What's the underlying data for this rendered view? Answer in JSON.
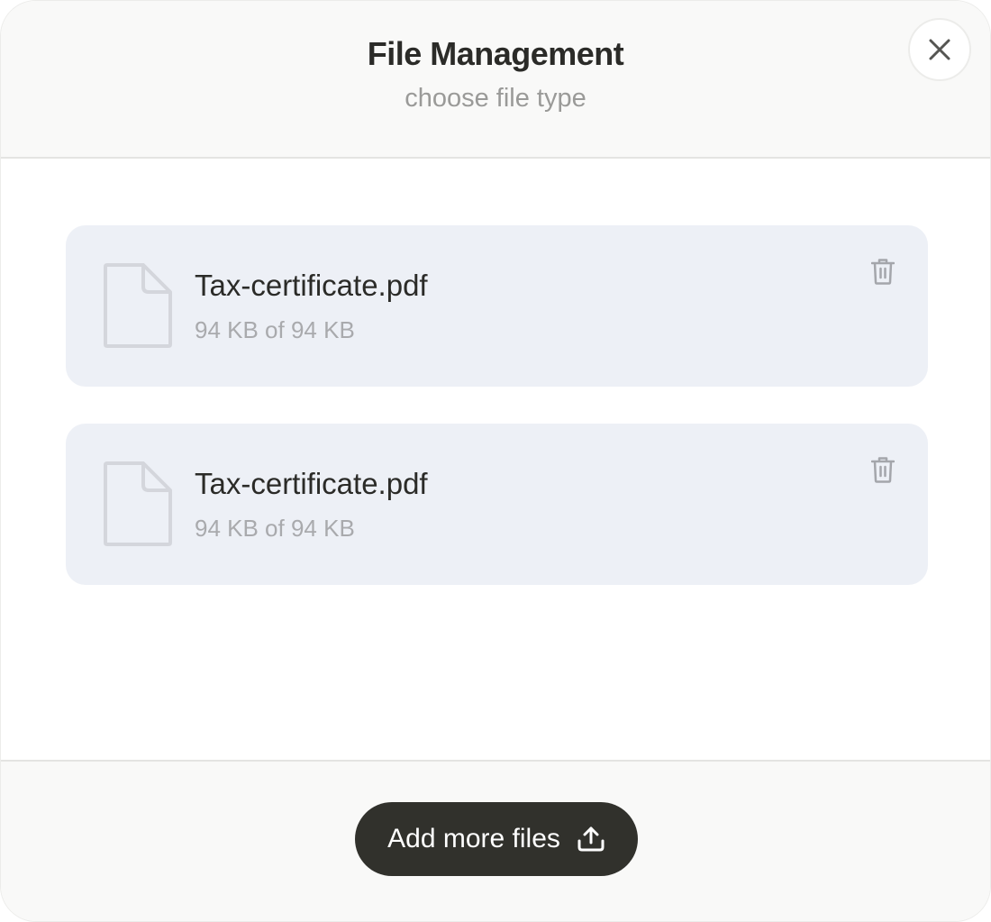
{
  "header": {
    "title": "File Management",
    "subtitle": "choose file type",
    "close_icon": "close-icon"
  },
  "files": [
    {
      "name": "Tax-certificate.pdf",
      "size": "94 KB of 94 KB",
      "icon": "file-icon",
      "action_icon": "trash-icon"
    },
    {
      "name": "Tax-certificate.pdf",
      "size": "94 KB of 94 KB",
      "icon": "file-icon",
      "action_icon": "trash-icon"
    }
  ],
  "footer": {
    "add_label": "Add more files",
    "add_icon": "upload-icon"
  },
  "colors": {
    "header_bg": "#f9f9f8",
    "card_bg": "#edf0f6",
    "button_bg": "#31312c",
    "text_primary": "#2b2b28",
    "text_muted": "#9a9a98"
  }
}
